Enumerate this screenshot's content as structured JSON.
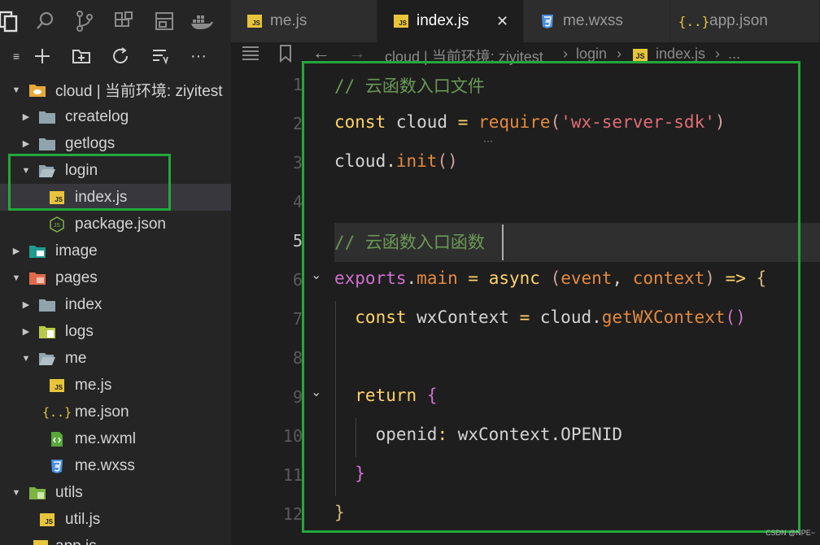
{
  "activity_bar": {
    "icons": [
      "explorer-icon",
      "search-icon",
      "source-control-icon",
      "extensions-icon",
      "layout-icon",
      "docker-icon"
    ]
  },
  "explorer_toolbar": {
    "icons": [
      "collapse-icon",
      "new-file-icon",
      "new-folder-icon",
      "refresh-icon",
      "sort-icon",
      "more-icon"
    ],
    "more_label": "···",
    "first_label": "≡"
  },
  "file_tree": {
    "items": [
      {
        "label": "cloud | 当前环境: ziyitest",
        "type": "cloud-folder",
        "expanded": true,
        "depth": 0
      },
      {
        "label": "createlog",
        "type": "folder",
        "expanded": false,
        "depth": 1
      },
      {
        "label": "getlogs",
        "type": "folder",
        "expanded": false,
        "depth": 1
      },
      {
        "label": "login",
        "type": "folder",
        "expanded": true,
        "depth": 1
      },
      {
        "label": "index.js",
        "type": "js",
        "depth": 2,
        "selected": true
      },
      {
        "label": "package.json",
        "type": "node",
        "depth": 2
      },
      {
        "label": "image",
        "type": "image-folder",
        "expanded": false,
        "depth": 0
      },
      {
        "label": "pages",
        "type": "pages-folder",
        "expanded": true,
        "depth": 0
      },
      {
        "label": "index",
        "type": "folder",
        "expanded": false,
        "depth": 1
      },
      {
        "label": "logs",
        "type": "logs-folder",
        "expanded": false,
        "depth": 1
      },
      {
        "label": "me",
        "type": "folder",
        "expanded": true,
        "depth": 1
      },
      {
        "label": "me.js",
        "type": "js",
        "depth": 2
      },
      {
        "label": "me.json",
        "type": "json",
        "depth": 2
      },
      {
        "label": "me.wxml",
        "type": "wxml",
        "depth": 2
      },
      {
        "label": "me.wxss",
        "type": "wxss",
        "depth": 2
      },
      {
        "label": "utils",
        "type": "utils-folder",
        "expanded": true,
        "depth": 0
      },
      {
        "label": "util.js",
        "type": "js",
        "depth": 1
      },
      {
        "label": "app.js",
        "type": "js",
        "depth": 0
      }
    ]
  },
  "tabs": [
    {
      "label": "me.js",
      "type": "js",
      "active": false
    },
    {
      "label": "index.js",
      "type": "js",
      "active": true,
      "close": "✕"
    },
    {
      "label": "me.wxss",
      "type": "wxss",
      "active": false
    },
    {
      "label": "app.json",
      "type": "json",
      "active": false
    }
  ],
  "breadcrumb": {
    "segments": [
      "cloud | 当前环境: ziyitest",
      "login",
      "index.js",
      "..."
    ],
    "separator": "›",
    "js_badge": "JS"
  },
  "editor": {
    "line_numbers": [
      "1",
      "2",
      "3",
      "4",
      "5",
      "6",
      "7",
      "8",
      "9",
      "10",
      "11",
      "12"
    ],
    "current_line": "5",
    "lines": [
      [
        {
          "t": "// 云函数入口文件",
          "c": "cmt"
        }
      ],
      [
        {
          "t": "const",
          "c": "kw"
        },
        {
          "t": " cloud ",
          "c": "ident"
        },
        {
          "t": "=",
          "c": "kw"
        },
        {
          "t": " ",
          "c": "ident"
        },
        {
          "t": "require",
          "c": "fn"
        },
        {
          "t": "(",
          "c": "par"
        },
        {
          "t": "'wx-server-sdk'",
          "c": "str"
        },
        {
          "t": ")",
          "c": "par"
        }
      ],
      [
        {
          "t": "cloud",
          "c": "ident"
        },
        {
          "t": ".",
          "c": "ident"
        },
        {
          "t": "init",
          "c": "fn"
        },
        {
          "t": "()",
          "c": "par"
        }
      ],
      [],
      [
        {
          "t": "// 云函数入口函数",
          "c": "cmt"
        }
      ],
      [
        {
          "t": "exports",
          "c": "kw2"
        },
        {
          "t": ".",
          "c": "ident"
        },
        {
          "t": "main",
          "c": "fn"
        },
        {
          "t": " ",
          "c": "ident"
        },
        {
          "t": "=",
          "c": "kw"
        },
        {
          "t": " ",
          "c": "ident"
        },
        {
          "t": "async",
          "c": "kw"
        },
        {
          "t": " (",
          "c": "par"
        },
        {
          "t": "event",
          "c": "fn"
        },
        {
          "t": ", ",
          "c": "ident"
        },
        {
          "t": "context",
          "c": "fn"
        },
        {
          "t": ")",
          "c": "par"
        },
        {
          "t": " => ",
          "c": "kw"
        },
        {
          "t": "{",
          "c": "brace"
        }
      ],
      [
        {
          "t": "  const",
          "c": "kw"
        },
        {
          "t": " wxContext ",
          "c": "ident"
        },
        {
          "t": "=",
          "c": "kw"
        },
        {
          "t": " cloud.",
          "c": "ident"
        },
        {
          "t": "getWXContext",
          "c": "fn"
        },
        {
          "t": "()",
          "c": "kw2"
        }
      ],
      [],
      [
        {
          "t": "  return",
          "c": "kw"
        },
        {
          "t": " ",
          "c": "ident"
        },
        {
          "t": "{",
          "c": "kw2"
        }
      ],
      [
        {
          "t": "    openid",
          "c": "ident"
        },
        {
          "t": ":",
          "c": "kw"
        },
        {
          "t": " wxContext.",
          "c": "ident"
        },
        {
          "t": "OPENID",
          "c": "ident"
        }
      ],
      [
        {
          "t": "  }",
          "c": "kw2"
        }
      ],
      [
        {
          "t": "}",
          "c": "brace"
        }
      ]
    ]
  },
  "colors": {
    "highlight_box": "#22a83a",
    "js_badge": "#e8c43b",
    "css_icon": "#4a8fe0"
  },
  "watermark": "CSDN @NPE~"
}
